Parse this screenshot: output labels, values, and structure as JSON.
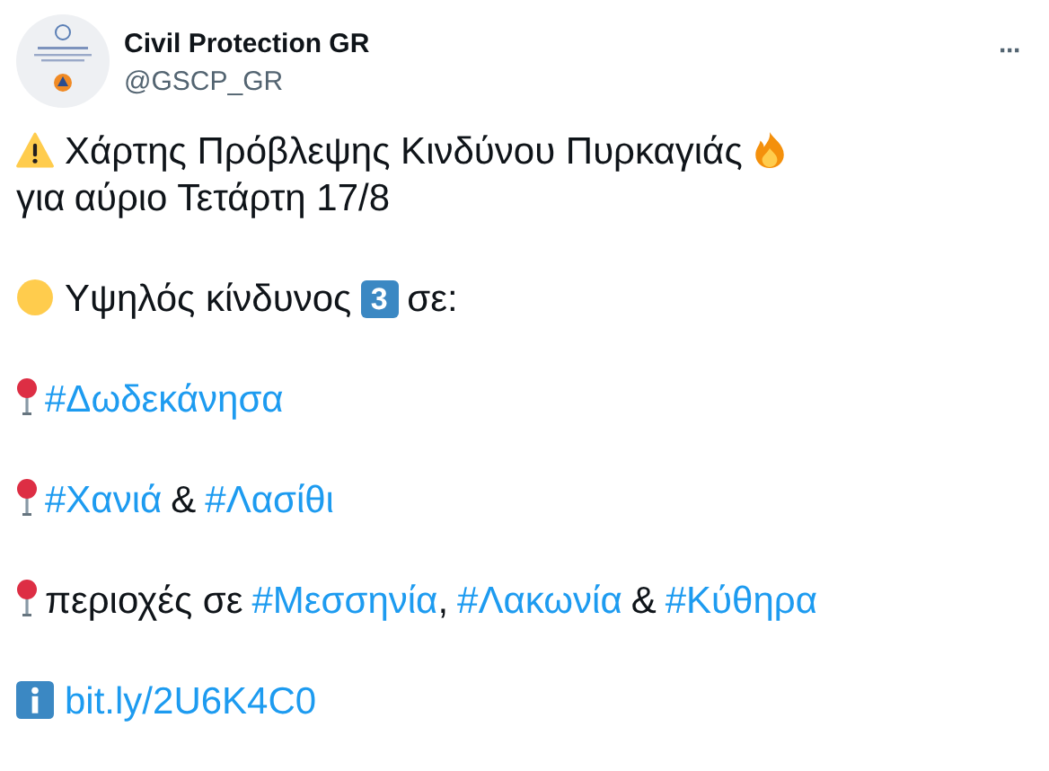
{
  "account": {
    "name": "Civil Protection GR",
    "handle": "@GSCP_GR"
  },
  "more_button": {
    "label": "···"
  },
  "paragraphs": [
    [
      {
        "kind": "warning"
      },
      {
        "kind": "text",
        "text": "Χάρτης Πρόβλεψης Κινδύνου Πυρκαγιάς"
      },
      {
        "kind": "fire"
      },
      {
        "kind": "text",
        "text": "για"
      },
      {
        "kind": "text",
        "text": "αύριο Τετάρτη 17/8"
      }
    ],
    [
      {
        "kind": "dot",
        "color": "#ffcc4d"
      },
      {
        "kind": "text",
        "text": "Υψηλός κίνδυνος"
      },
      {
        "kind": "keycap",
        "text": "3"
      },
      {
        "kind": "text",
        "text": "σε:"
      }
    ],
    [
      {
        "kind": "pin"
      },
      {
        "kind": "tag",
        "text": "#Δωδεκάνησα"
      }
    ],
    [
      {
        "kind": "pin"
      },
      {
        "kind": "tag",
        "text": "#Χανιά"
      },
      {
        "kind": "text",
        "text": "&"
      },
      {
        "kind": "tag",
        "text": "#Λασίθι"
      }
    ],
    [
      {
        "kind": "pin"
      },
      {
        "kind": "text",
        "text": "περιοχές σε"
      },
      {
        "kind": "tag",
        "text": "#Μεσσηνία"
      },
      {
        "kind": "punct",
        "text": ","
      },
      {
        "kind": "tag",
        "text": "#Λακωνία"
      },
      {
        "kind": "text",
        "text": "&"
      },
      {
        "kind": "tag",
        "text": "#Κύθηρα"
      }
    ],
    [
      {
        "kind": "info"
      },
      {
        "kind": "link",
        "text": "bit.ly/2U6K4C0"
      }
    ]
  ]
}
